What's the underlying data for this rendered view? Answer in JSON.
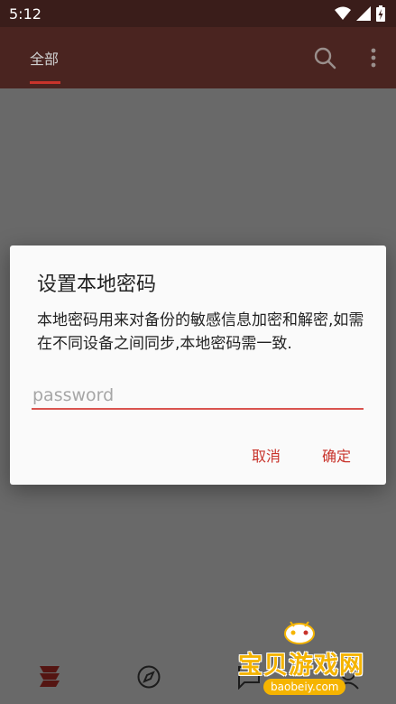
{
  "status_bar": {
    "time": "5:12",
    "icons": [
      "wifi-icon",
      "signal-icon",
      "battery-icon"
    ]
  },
  "app_bar": {
    "tab_label": "全部",
    "actions": [
      "search-icon",
      "more-vert-icon"
    ]
  },
  "dialog": {
    "title": "设置本地密码",
    "message": "本地密码用来对备份的敏感信息加密和解密,如需在不同设备之间同步,本地密码需一致.",
    "input_placeholder": "password",
    "input_value": "",
    "cancel_label": "取消",
    "confirm_label": "确定"
  },
  "bottom_nav": {
    "items": [
      "app-logo-icon",
      "compass-icon",
      "message-icon",
      "user-icon"
    ]
  },
  "watermark": {
    "title": "宝贝游戏网",
    "url": "baobeiy.com"
  },
  "colors": {
    "accent": "#c8332b",
    "app_bar": "#4a2420",
    "status_bar": "#3a1d1a"
  }
}
